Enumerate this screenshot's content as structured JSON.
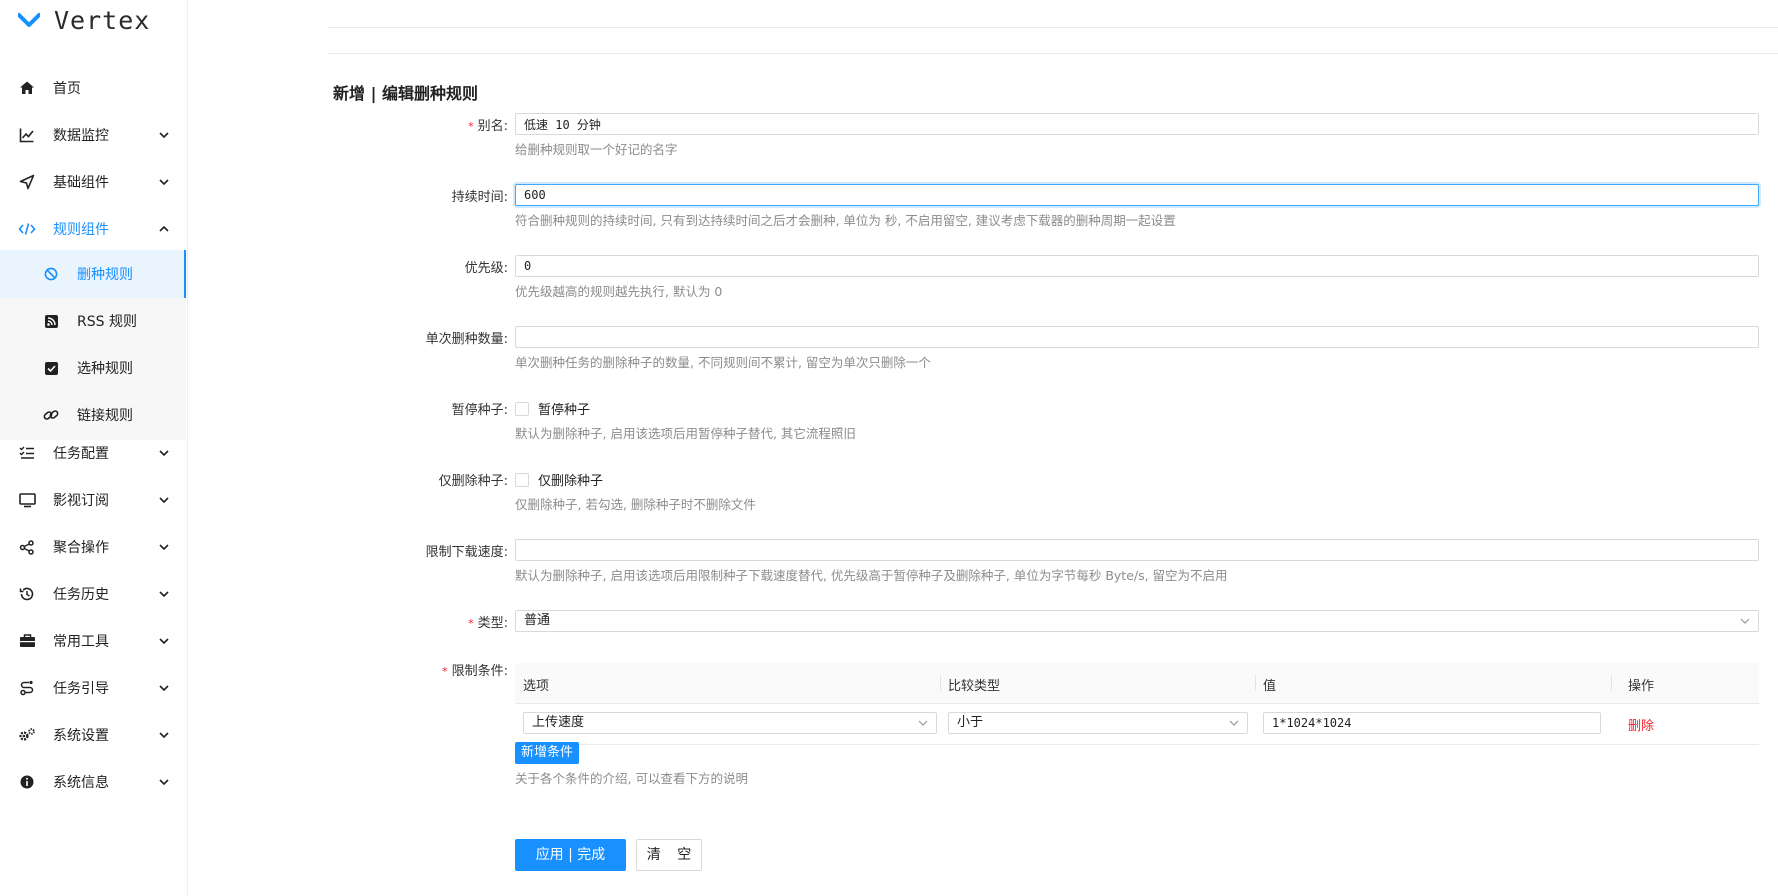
{
  "app": {
    "name": "Vertex",
    "accent": "#1890ff",
    "danger": "#f5222d"
  },
  "sidebar": {
    "items": [
      {
        "label": "首页",
        "icon": "home-icon"
      },
      {
        "label": "数据监控",
        "icon": "line-chart-icon"
      },
      {
        "label": "基础组件",
        "icon": "send-icon"
      },
      {
        "label": "规则组件",
        "icon": "code-icon"
      },
      {
        "label": "任务配置",
        "icon": "checklist-icon"
      },
      {
        "label": "影视订阅",
        "icon": "monitor-icon"
      },
      {
        "label": "聚合操作",
        "icon": "share-icon"
      },
      {
        "label": "任务历史",
        "icon": "history-icon"
      },
      {
        "label": "常用工具",
        "icon": "toolbox-icon"
      },
      {
        "label": "任务引导",
        "icon": "guide-icon"
      },
      {
        "label": "系统设置",
        "icon": "settings-icon"
      },
      {
        "label": "系统信息",
        "icon": "info-icon"
      }
    ],
    "sub_items": [
      {
        "label": "删种规则",
        "icon": "ban-icon"
      },
      {
        "label": "RSS 规则",
        "icon": "rss-icon"
      },
      {
        "label": "选种规则",
        "icon": "checkbox-icon"
      },
      {
        "label": "链接规则",
        "icon": "link-icon"
      }
    ]
  },
  "form": {
    "title": "新增 | 编辑删种规则",
    "alias": {
      "label": "别名:",
      "value": "低速 10 分钟",
      "hint": "给删种规则取一个好记的名字"
    },
    "duration": {
      "label": "持续时间:",
      "value": "600",
      "hint": "符合删种规则的持续时间, 只有到达持续时间之后才会删种, 单位为 秒, 不启用留空, 建议考虑下载器的删种周期一起设置"
    },
    "priority": {
      "label": "优先级:",
      "value": "0",
      "hint": "优先级越高的规则越先执行, 默认为 0"
    },
    "max_delete": {
      "label": "单次删种数量:",
      "value": "",
      "hint": "单次删种任务的删除种子的数量, 不同规则间不累计, 留空为单次只删除一个"
    },
    "pause": {
      "label": "暂停种子:",
      "check_label": "暂停种子",
      "hint": "默认为删除种子, 启用该选项后用暂停种子替代, 其它流程照旧"
    },
    "only_delete_torrent": {
      "label": "仅删除种子:",
      "check_label": "仅删除种子",
      "hint": "仅删除种子, 若勾选, 删除种子时不删除文件"
    },
    "limit_speed": {
      "label": "限制下载速度:",
      "value": "",
      "hint": "默认为删除种子, 启用该选项后用限制种子下载速度替代, 优先级高于暂停种子及删除种子, 单位为字节每秒 Byte/s, 留空为不启用"
    },
    "type": {
      "label": "类型:",
      "value": "普通"
    },
    "conditions": {
      "label": "限制条件:",
      "columns": [
        "选项",
        "比较类型",
        "值",
        "操作"
      ],
      "rows": [
        {
          "option": "上传速度",
          "compare": "小于",
          "value": "1*1024*1024",
          "action": "删除"
        }
      ],
      "add_label": "新增条件",
      "hint": "关于各个条件的介绍, 可以查看下方的说明"
    },
    "submit_label": "应用 | 完成",
    "clear_label": "清 空"
  }
}
